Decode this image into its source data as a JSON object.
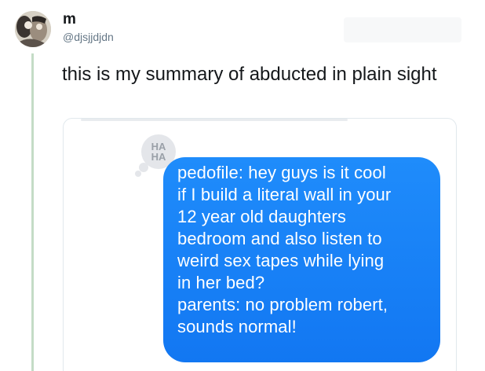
{
  "tweet": {
    "display_name": "m",
    "handle": "@djsjjdjdn",
    "text": "this is my summary of abducted in plain sight"
  },
  "media": {
    "reaction_badge": {
      "line1": "HA",
      "line2": "HA"
    },
    "message_lines": [
      "pedofile: hey guys is it cool",
      "if I build a literal wall in your",
      "12 year old daughters",
      "bedroom and also listen to",
      "weird sex tapes while lying",
      "in her bed?",
      "parents: no problem robert,",
      "sounds normal!"
    ]
  },
  "colors": {
    "bubble": "#1f8cfb",
    "thread_line": "#c4dcc6",
    "handle": "#657786"
  },
  "icons": {
    "avatar": "profile-photo",
    "reaction": "haha-reaction-icon"
  }
}
